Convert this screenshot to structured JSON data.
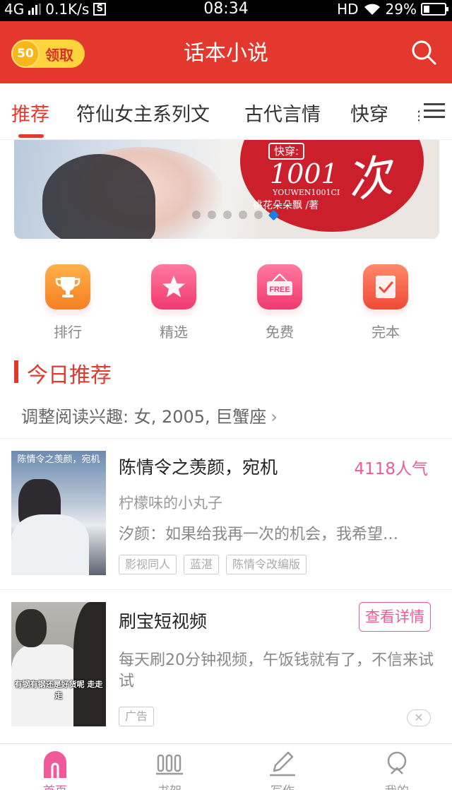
{
  "status_bar": {
    "network": "4G",
    "speed": "0.1K/s",
    "s_badge": "S",
    "time": "08:34",
    "hd": "HD",
    "battery": "29%",
    "battery_level": 0.29
  },
  "header": {
    "coins": "50",
    "claim_label": "领取",
    "title": "话本小说",
    "search_icon": "search-icon"
  },
  "tabs": [
    {
      "label": "推荐",
      "active": true
    },
    {
      "label": "符仙女主系列文",
      "active": false
    },
    {
      "label": "古代言情",
      "active": false
    },
    {
      "label": "快穿",
      "active": false
    },
    {
      "label": "纟",
      "active": false
    }
  ],
  "banner": {
    "tag": "快穿:",
    "title_num": "1001",
    "subtitle": "YOUWEN1001CI",
    "author": "桃花朵朵飘 /著",
    "calligraphy": "次",
    "dots": 6,
    "active_dot": 5
  },
  "categories": [
    {
      "label": "排行",
      "icon": "trophy-icon"
    },
    {
      "label": "精选",
      "icon": "star-icon"
    },
    {
      "label": "免费",
      "icon": "free-sign-icon",
      "icon_text": "FREE"
    },
    {
      "label": "完本",
      "icon": "finished-book-icon"
    }
  ],
  "section": {
    "title": "今日推荐",
    "interest": "调整阅读兴趣: 女, 2005, 巨蟹座",
    "chevron": "›"
  },
  "books": [
    {
      "cover_caption": "陈情令之羡颜，宛机",
      "title": "陈情令之羡颜，宛机",
      "popularity": "4118人气",
      "author": "柠檬味的小丸子",
      "desc": "汐颜：如果给我再一次的机会，我希望…",
      "tags": [
        "影视同人",
        "蓝湛",
        "陈情令改编版"
      ]
    }
  ],
  "ad": {
    "cover_caption": "有钢有钢还是好货呢 走走走",
    "title": "刷宝短视频",
    "button": "查看详情",
    "desc": "每天刷20分钟视频，午饭钱就有了，不信来试试",
    "tag": "广告",
    "close": "✕"
  },
  "bottom_nav": [
    {
      "label": "首页",
      "icon": "home-icon",
      "active": true
    },
    {
      "label": "书架",
      "icon": "bookshelf-icon",
      "active": false
    },
    {
      "label": "写作",
      "icon": "pen-icon",
      "active": false
    },
    {
      "label": "我的",
      "icon": "profile-icon",
      "active": false
    }
  ],
  "colors": {
    "brand_red": "#e4382f",
    "accent_pink": "#f05a9a"
  }
}
